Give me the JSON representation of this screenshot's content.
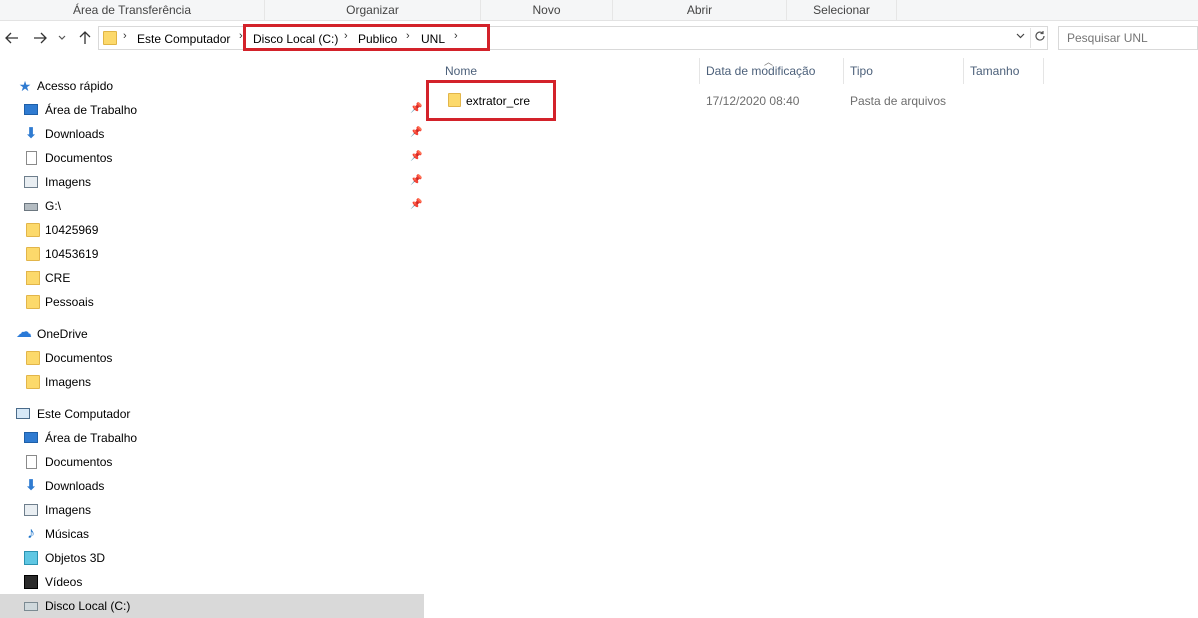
{
  "ribbon": {
    "groups": [
      "Área de Transferência",
      "Organizar",
      "Novo",
      "Abrir",
      "Selecionar"
    ]
  },
  "nav": {
    "back_icon": "arrow-left-icon",
    "forward_icon": "arrow-right-icon",
    "recent_icon": "chevron-down-icon",
    "up_icon": "arrow-up-icon",
    "path": [
      "Este Computador",
      "Disco Local (C:)",
      "Publico",
      "UNL"
    ],
    "refresh_icon": "refresh-icon",
    "search_placeholder": "Pesquisar UNL"
  },
  "sidebar": {
    "items": [
      {
        "label": "Acesso rápido",
        "icon": "star-icon",
        "pinned": false
      },
      {
        "label": "Área de Trabalho",
        "icon": "desktop-icon",
        "pinned": true
      },
      {
        "label": "Downloads",
        "icon": "download-icon",
        "pinned": true
      },
      {
        "label": "Documentos",
        "icon": "document-icon",
        "pinned": true
      },
      {
        "label": "Imagens",
        "icon": "image-icon",
        "pinned": true
      },
      {
        "label": "G:\\",
        "icon": "network-drive-icon",
        "pinned": true
      },
      {
        "label": "10425969",
        "icon": "folder-icon",
        "pinned": false
      },
      {
        "label": "10453619",
        "icon": "folder-icon",
        "pinned": false
      },
      {
        "label": "CRE",
        "icon": "folder-icon",
        "pinned": false
      },
      {
        "label": "Pessoais",
        "icon": "folder-icon",
        "pinned": false
      },
      {
        "label": "OneDrive",
        "icon": "cloud-icon",
        "pinned": false
      },
      {
        "label": "Documentos",
        "icon": "folder-icon",
        "pinned": false
      },
      {
        "label": "Imagens",
        "icon": "folder-icon",
        "pinned": false
      },
      {
        "label": "Este Computador",
        "icon": "computer-icon",
        "pinned": false
      },
      {
        "label": "Área de Trabalho",
        "icon": "desktop-icon",
        "pinned": false
      },
      {
        "label": "Documentos",
        "icon": "document-icon",
        "pinned": false
      },
      {
        "label": "Downloads",
        "icon": "download-icon",
        "pinned": false
      },
      {
        "label": "Imagens",
        "icon": "image-icon",
        "pinned": false
      },
      {
        "label": "Músicas",
        "icon": "music-icon",
        "pinned": false
      },
      {
        "label": "Objetos 3D",
        "icon": "cube-icon",
        "pinned": false
      },
      {
        "label": "Vídeos",
        "icon": "video-icon",
        "pinned": false
      },
      {
        "label": "Disco Local (C:)",
        "icon": "drive-icon",
        "pinned": false,
        "selected": true
      }
    ],
    "pin_icon": "pin-icon"
  },
  "content": {
    "columns": [
      "Nome",
      "Data de modificação",
      "Tipo",
      "Tamanho"
    ],
    "rows": [
      {
        "name": "extrator_cre",
        "modified": "17/12/2020 08:40",
        "type": "Pasta de arquivos",
        "size": ""
      }
    ]
  },
  "colors": {
    "highlight_box": "#d3222a",
    "folder": "#fcd96b",
    "column_header_text": "#4c607a",
    "selection": "#d9d9d9"
  }
}
